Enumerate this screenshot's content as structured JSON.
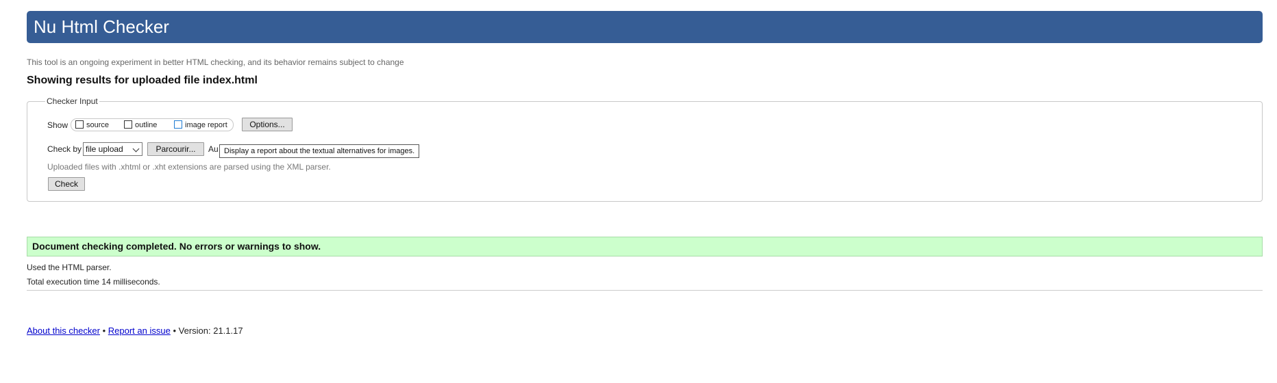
{
  "header": {
    "title": "Nu Html Checker"
  },
  "intro_note": "This tool is an ongoing experiment in better HTML checking, and its behavior remains subject to change",
  "results_title": "Showing results for uploaded file index.html",
  "checker_input": {
    "legend": "Checker Input",
    "show_label": "Show",
    "show_options": [
      {
        "label": "source",
        "checked": false
      },
      {
        "label": "outline",
        "checked": false
      },
      {
        "label": "image report",
        "checked": false
      }
    ],
    "options_button": "Options...",
    "check_by_label": "Check by",
    "check_by_selected": "file upload",
    "browse_button": "Parcourir...",
    "file_status_partial": "Au",
    "tooltip": "Display a report about the textual alternatives for images.",
    "uploaded_note": "Uploaded files with .xhtml or .xht extensions are parsed using the XML parser.",
    "check_button": "Check"
  },
  "result": {
    "message": "Document checking completed. No errors or warnings to show.",
    "parser_note": "Used the HTML parser.",
    "execution_time": "Total execution time 14 milliseconds."
  },
  "footer": {
    "about_link": "About this checker",
    "separator": "•",
    "report_link": "Report an issue",
    "version_text": "Version: 21.1.17"
  },
  "colors": {
    "header_bg": "#365d95",
    "success_bg": "#ccffcc",
    "link": "#0000cc"
  }
}
